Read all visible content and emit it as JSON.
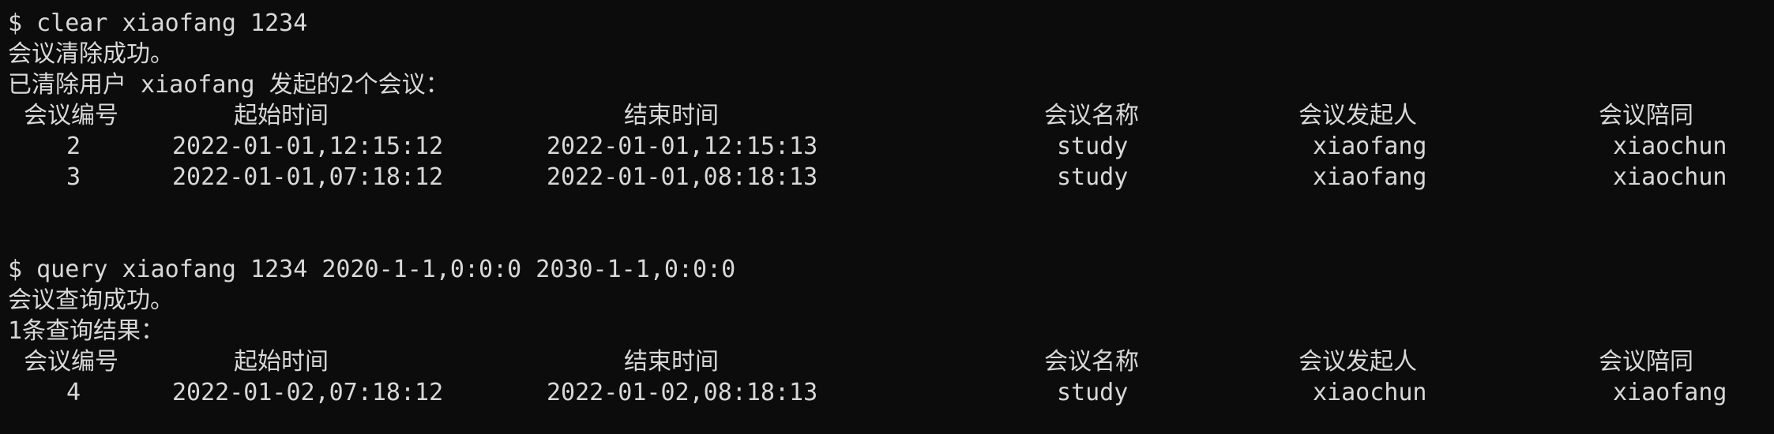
{
  "colors": {
    "background": "#0c0c0c",
    "text": "#d8d8d8"
  },
  "session1": {
    "command": "$ clear xiaofang 1234",
    "message": "会议清除成功。",
    "summary": "已清除用户 xiaofang 发起的2个会议：",
    "headers": [
      "会议编号",
      "起始时间",
      "结束时间",
      "会议名称",
      "会议发起人",
      "会议陪同"
    ],
    "rows": [
      [
        "2",
        "2022-01-01,12:15:12",
        "2022-01-01,12:15:13",
        "study",
        "xiaofang",
        "xiaochun"
      ],
      [
        "3",
        "2022-01-01,07:18:12",
        "2022-01-01,08:18:13",
        "study",
        "xiaofang",
        "xiaochun"
      ]
    ]
  },
  "session2": {
    "command": "$ query xiaofang 1234 2020-1-1,0:0:0 2030-1-1,0:0:0",
    "message": "会议查询成功。",
    "summary": "1条查询结果：",
    "headers": [
      "会议编号",
      "起始时间",
      "结束时间",
      "会议名称",
      "会议发起人",
      "会议陪同"
    ],
    "rows": [
      [
        "4",
        "2022-01-02,07:18:12",
        "2022-01-02,08:18:13",
        "study",
        "xiaochun",
        "xiaofang"
      ]
    ]
  }
}
